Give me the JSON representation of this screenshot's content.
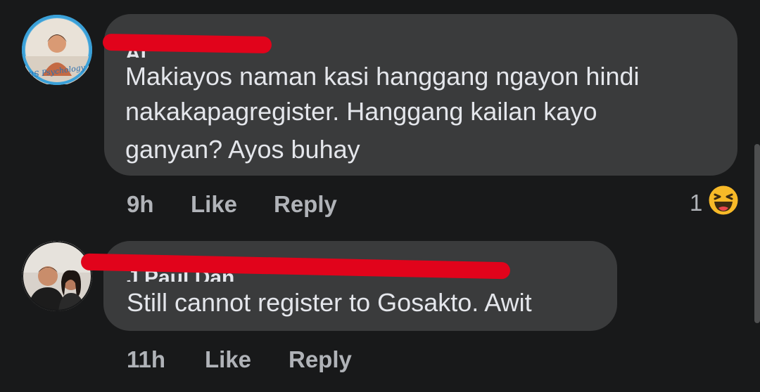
{
  "comments": [
    {
      "author": "Ai",
      "avatar_caption": "BS Psychology",
      "text_lines": [
        "Makiayos naman kasi hanggang ngayon hindi",
        "nakakapagregister. Hanggang kailan kayo",
        "ganyan? Ayos buhay"
      ],
      "time": "9h",
      "like_label": "Like",
      "reply_label": "Reply",
      "reaction_count": "1",
      "reaction_icon": "haha-emoji-icon"
    },
    {
      "author": "J Paul Dan",
      "text_lines": [
        "Still cannot register to Gosakto. Awit"
      ],
      "time": "11h",
      "like_label": "Like",
      "reply_label": "Reply"
    }
  ],
  "colors": {
    "background": "#18191a",
    "bubble": "#3a3b3c",
    "text": "#e4e6eb",
    "meta": "#b0b3b8",
    "redaction": "#e1031b",
    "avatar_ring": "#3aa0d8"
  }
}
